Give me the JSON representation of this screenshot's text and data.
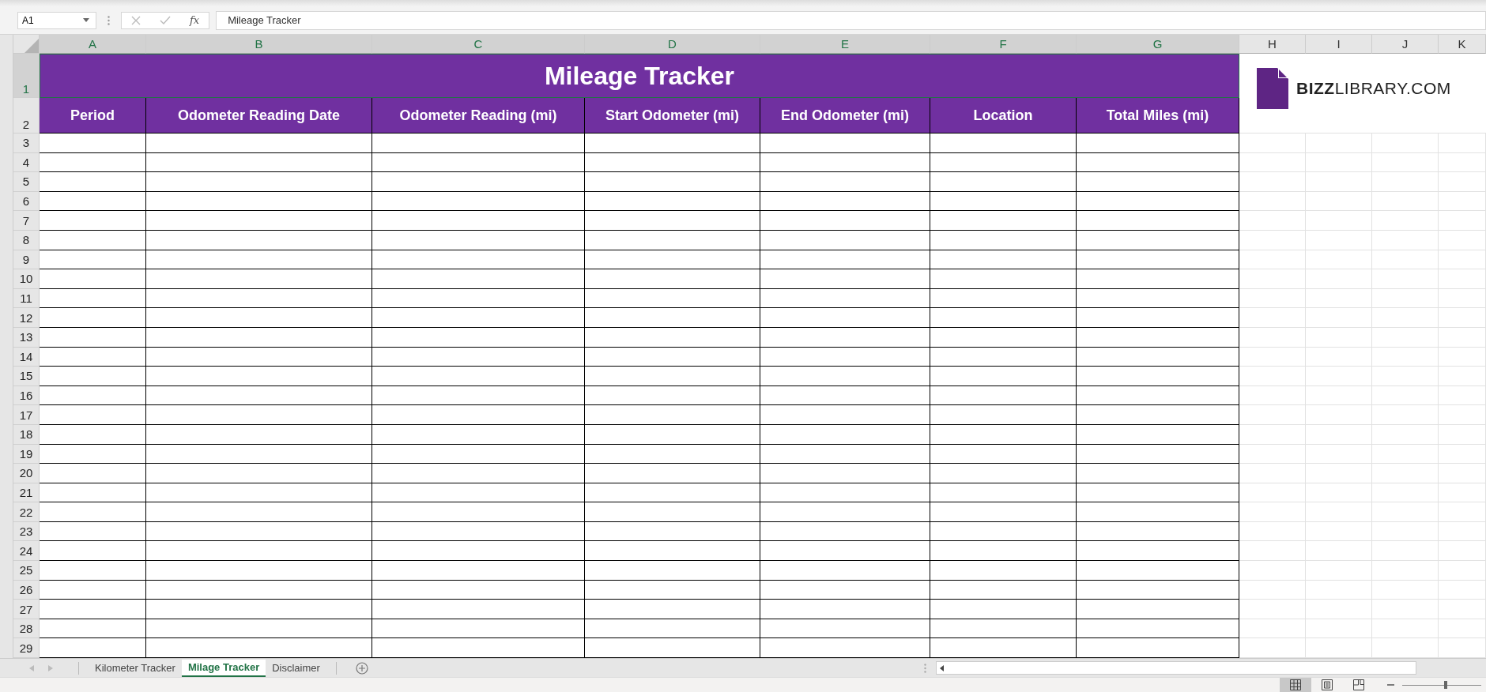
{
  "formula_bar": {
    "name_box": "A1",
    "formula": "Mileage Tracker",
    "function_symbol": "fx"
  },
  "columns": [
    {
      "label": "A",
      "selected": true
    },
    {
      "label": "B",
      "selected": true
    },
    {
      "label": "C",
      "selected": true
    },
    {
      "label": "D",
      "selected": true
    },
    {
      "label": "E",
      "selected": true
    },
    {
      "label": "F",
      "selected": true
    },
    {
      "label": "G",
      "selected": true
    },
    {
      "label": "H",
      "selected": false
    },
    {
      "label": "I",
      "selected": false
    },
    {
      "label": "J",
      "selected": false
    },
    {
      "label": "K",
      "selected": false
    }
  ],
  "title_row": {
    "number": "1",
    "selected": true,
    "title": "Mileage Tracker"
  },
  "header_row": {
    "number": "2",
    "selected": false,
    "headers": [
      "Period",
      "Odometer Reading Date",
      "Odometer Reading (mi)",
      "Start Odometer (mi)",
      "End Odometer (mi)",
      "Location",
      "Total Miles (mi)"
    ]
  },
  "rows": [
    {
      "number": "3",
      "selected": false
    },
    {
      "number": "4",
      "selected": false
    },
    {
      "number": "5",
      "selected": false
    },
    {
      "number": "6",
      "selected": false
    },
    {
      "number": "7",
      "selected": false
    },
    {
      "number": "8",
      "selected": false
    },
    {
      "number": "9",
      "selected": false
    },
    {
      "number": "10",
      "selected": false
    },
    {
      "number": "11",
      "selected": false
    },
    {
      "number": "12",
      "selected": false
    },
    {
      "number": "13",
      "selected": false
    },
    {
      "number": "14",
      "selected": false
    },
    {
      "number": "15",
      "selected": false
    },
    {
      "number": "16",
      "selected": false
    },
    {
      "number": "17",
      "selected": false
    },
    {
      "number": "18",
      "selected": false
    },
    {
      "number": "19",
      "selected": false
    },
    {
      "number": "20",
      "selected": false
    },
    {
      "number": "21",
      "selected": false
    },
    {
      "number": "22",
      "selected": false
    },
    {
      "number": "23",
      "selected": false
    },
    {
      "number": "24",
      "selected": false
    },
    {
      "number": "25",
      "selected": false
    },
    {
      "number": "26",
      "selected": false
    },
    {
      "number": "27",
      "selected": false
    },
    {
      "number": "28",
      "selected": false
    },
    {
      "number": "29",
      "selected": false
    }
  ],
  "logo": {
    "text": "**BIZZ**LIBRARY.COM"
  },
  "sheet_tabs": [
    {
      "label": "Kilometer Tracker",
      "selected": false
    },
    {
      "label": "Milage Tracker",
      "selected": true
    },
    {
      "label": "Disclaimer",
      "selected": false
    }
  ],
  "status_bar": {
    "views": [
      {
        "kind": "normal",
        "selected": true
      },
      {
        "kind": "page-layout",
        "selected": false
      },
      {
        "kind": "page-break",
        "selected": false
      }
    ],
    "zoom": {
      "level": 0.55
    }
  }
}
